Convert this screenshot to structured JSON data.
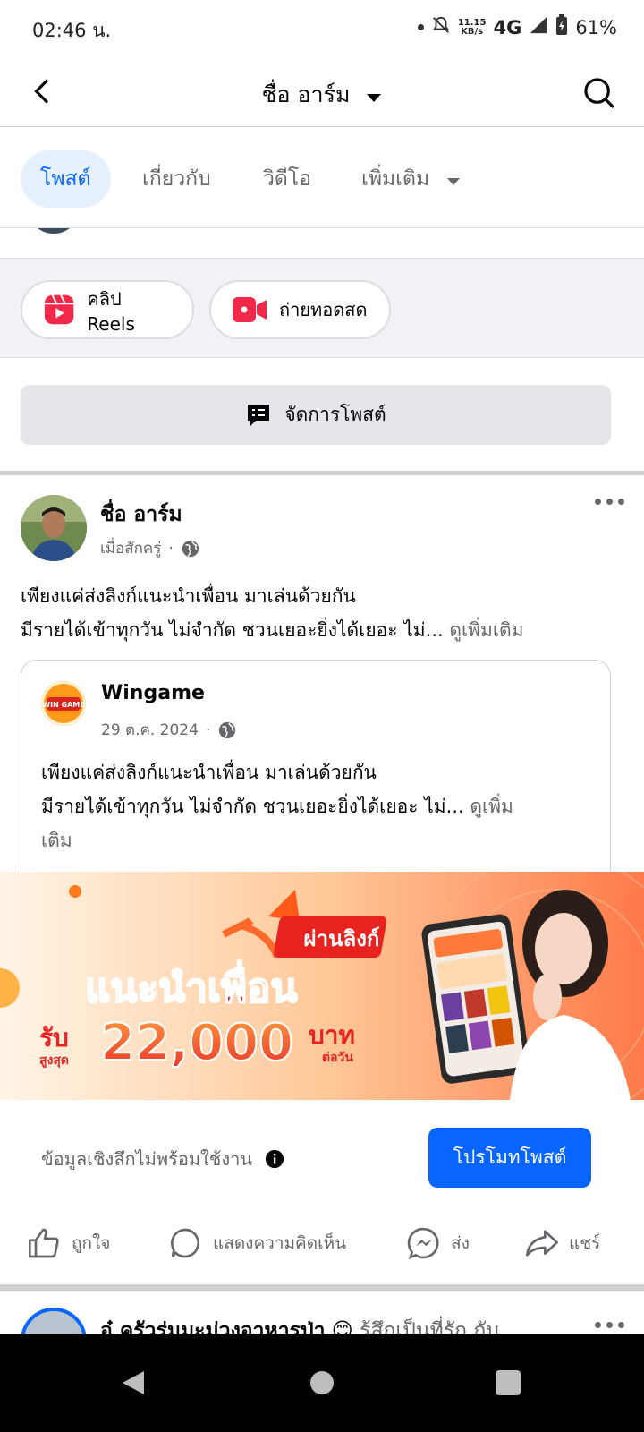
{
  "status_bar": {
    "time": "02:46 น.",
    "net_speed_top": "11.15",
    "net_speed_bottom": "KB/s",
    "network": "4G",
    "battery": "61%"
  },
  "app_bar": {
    "title": "ชื่อ อาร์ม"
  },
  "tabs": [
    {
      "label": "โพสต์",
      "active": true
    },
    {
      "label": "เกี่ยวกับ",
      "active": false
    },
    {
      "label": "วิดีโอ",
      "active": false
    },
    {
      "label": "เพิ่มเติม",
      "active": false
    }
  ],
  "create": {
    "reels_label": "คลิป Reels",
    "live_label": "ถ่ายทอดสด"
  },
  "manage": {
    "label": "จัดการโพสต์"
  },
  "post": {
    "author": "ชื่อ อาร์ม",
    "time": "เมื่อสักครู่",
    "separator": "·",
    "text_line1": "เพียงแค่ส่งลิงก์แนะนำเพื่อน มาเล่นด้วยกัน",
    "text_line2": "มีรายได้เข้าทุกวัน ไม่จำกัด ชวนเยอะยิ่งได้เยอะ ไม่...",
    "see_more": "ดูเพิ่มเติม",
    "shared": {
      "name": "Wingame",
      "logo_text": "WIN GAME",
      "date": "29 ต.ค. 2024",
      "separator": "·",
      "text_line1": "เพียงแค่ส่งลิงก์แนะนำเพื่อน มาเล่นด้วยกัน",
      "text_line2": "มีรายได้เข้าทุกวัน ไม่จำกัด ชวนเยอะยิ่งได้เยอะ ไม่...",
      "see_more_a": "ดูเพิ่ม",
      "see_more_b": "เติม"
    },
    "banner": {
      "tag": "ผ่านลิงก์",
      "headline": "แนะนำเพื่อน",
      "receive": "รับ",
      "max": "สูงสุด",
      "amount": "22,000",
      "currency": "บาท",
      "per_day": "ต่อวัน"
    },
    "insights_text": "ข้อมูลเชิงลึกไม่พร้อมใช้งาน",
    "promote_label": "โปรโมทโพสต์",
    "actions": {
      "like": "ถูกใจ",
      "comment": "แสดงความคิดเห็น",
      "send": "ส่ง",
      "share": "แชร์"
    }
  },
  "next_post": {
    "author": "อ๋ ครัวร่มมะม่วงอาหารป่า",
    "feeling": "รู้สึกเป็นที่รัก กับ"
  },
  "colors": {
    "accent": "#0866ff",
    "secondary_text": "#65676b",
    "banner_bg": "#ffb98a"
  }
}
